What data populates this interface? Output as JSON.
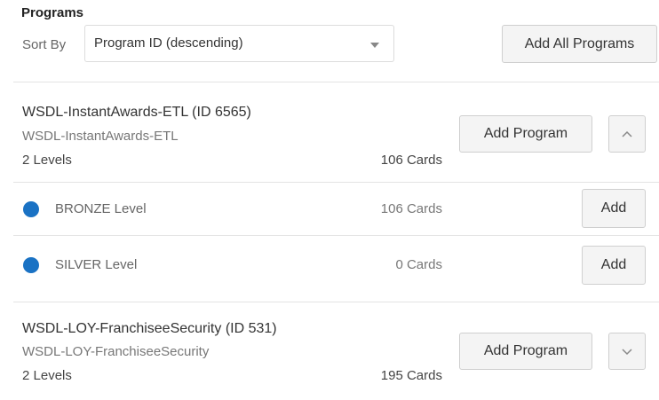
{
  "header": {
    "title": "Programs"
  },
  "sort": {
    "label": "Sort By",
    "value": "Program ID (descending)"
  },
  "actions": {
    "add_all_label": "Add All Programs"
  },
  "programs": [
    {
      "title": "WSDL-InstantAwards-ETL (ID 6565)",
      "subtitle": "WSDL-InstantAwards-ETL",
      "levels_text": "2 Levels",
      "cards_text": "106 Cards",
      "add_label": "Add Program",
      "expanded": true,
      "toggle_icon": "chevron-up-icon",
      "levels": [
        {
          "name": "BRONZE Level",
          "cards": "106 Cards",
          "add_label": "Add",
          "dot_color": "#1a72c4"
        },
        {
          "name": "SILVER Level",
          "cards": "0 Cards",
          "add_label": "Add",
          "dot_color": "#1a72c4"
        }
      ]
    },
    {
      "title": "WSDL-LOY-FranchiseeSecurity (ID 531)",
      "subtitle": "WSDL-LOY-FranchiseeSecurity",
      "levels_text": "2 Levels",
      "cards_text": "195 Cards",
      "add_label": "Add Program",
      "expanded": false,
      "toggle_icon": "chevron-down-icon"
    }
  ],
  "colors": {
    "level_dot": "#1a72c4",
    "button_bg": "#f4f4f4",
    "divider": "#e4e4e4"
  }
}
